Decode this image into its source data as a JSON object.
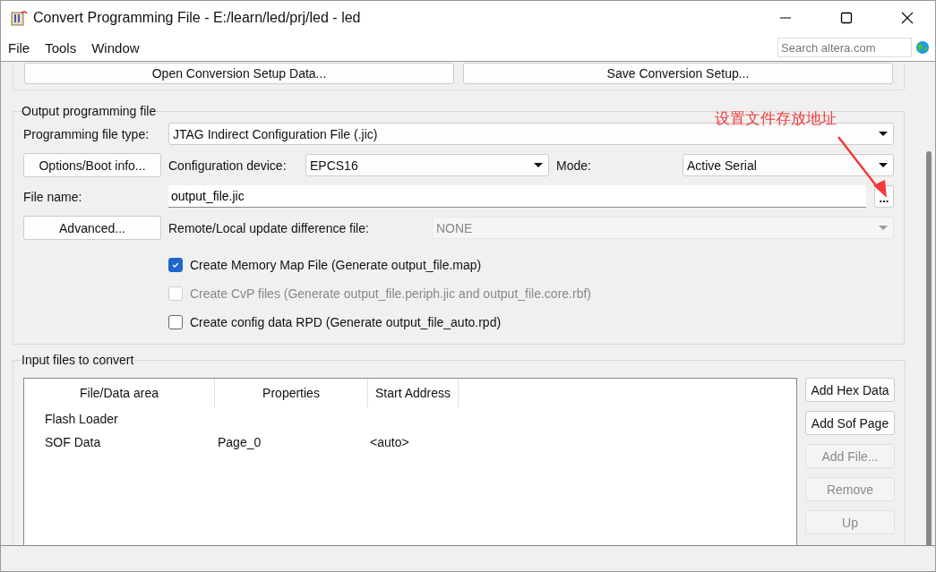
{
  "window": {
    "title": "Convert Programming File - E:/learn/led/prj/led - led"
  },
  "menu": [
    "File",
    "Tools",
    "Window"
  ],
  "search": {
    "placeholder": "Search altera.com"
  },
  "top_buttons": [
    "Open Conversion Setup Data...",
    "Save Conversion Setup..."
  ],
  "output_group": {
    "title": "Output programming file",
    "programming_file_type": {
      "label": "Programming file type:",
      "value": "JTAG Indirect Configuration File (.jic)"
    },
    "options_button": "Options/Boot info...",
    "configuration_device": {
      "label": "Configuration device:",
      "value": "EPCS16"
    },
    "mode": {
      "label": "Mode:",
      "value": "Active Serial"
    },
    "file_name": {
      "label": "File name:",
      "value": "output_file.jic"
    },
    "browse_button": "...",
    "advanced_button": "Advanced...",
    "difference_file": {
      "label": "Remote/Local update difference file:",
      "value": "NONE",
      "disabled": true
    },
    "options": [
      {
        "label": "Create Memory Map File (Generate output_file.map)",
        "checked": true,
        "disabled": false
      },
      {
        "label": "Create CvP files (Generate output_file.periph.jic and output_file.core.rbf)",
        "checked": false,
        "disabled": true
      },
      {
        "label": "Create config data RPD (Generate output_file_auto.rpd)",
        "checked": false,
        "disabled": false
      }
    ]
  },
  "annotation": {
    "text": "设置文件存放地址"
  },
  "input_group": {
    "title": "Input files to convert",
    "table": {
      "columns": [
        "File/Data area",
        "Properties",
        "Start Address"
      ],
      "rows": [
        [
          "Flash Loader"
        ],
        [
          "SOF Data",
          "Page_0",
          "<auto>"
        ]
      ]
    },
    "buttons": [
      {
        "label": "Add Hex Data",
        "disabled": false
      },
      {
        "label": "Add Sof Page",
        "disabled": false
      },
      {
        "label": "Add File...",
        "disabled": true
      },
      {
        "label": "Remove",
        "disabled": true
      },
      {
        "label": "Up",
        "disabled": true
      }
    ]
  }
}
